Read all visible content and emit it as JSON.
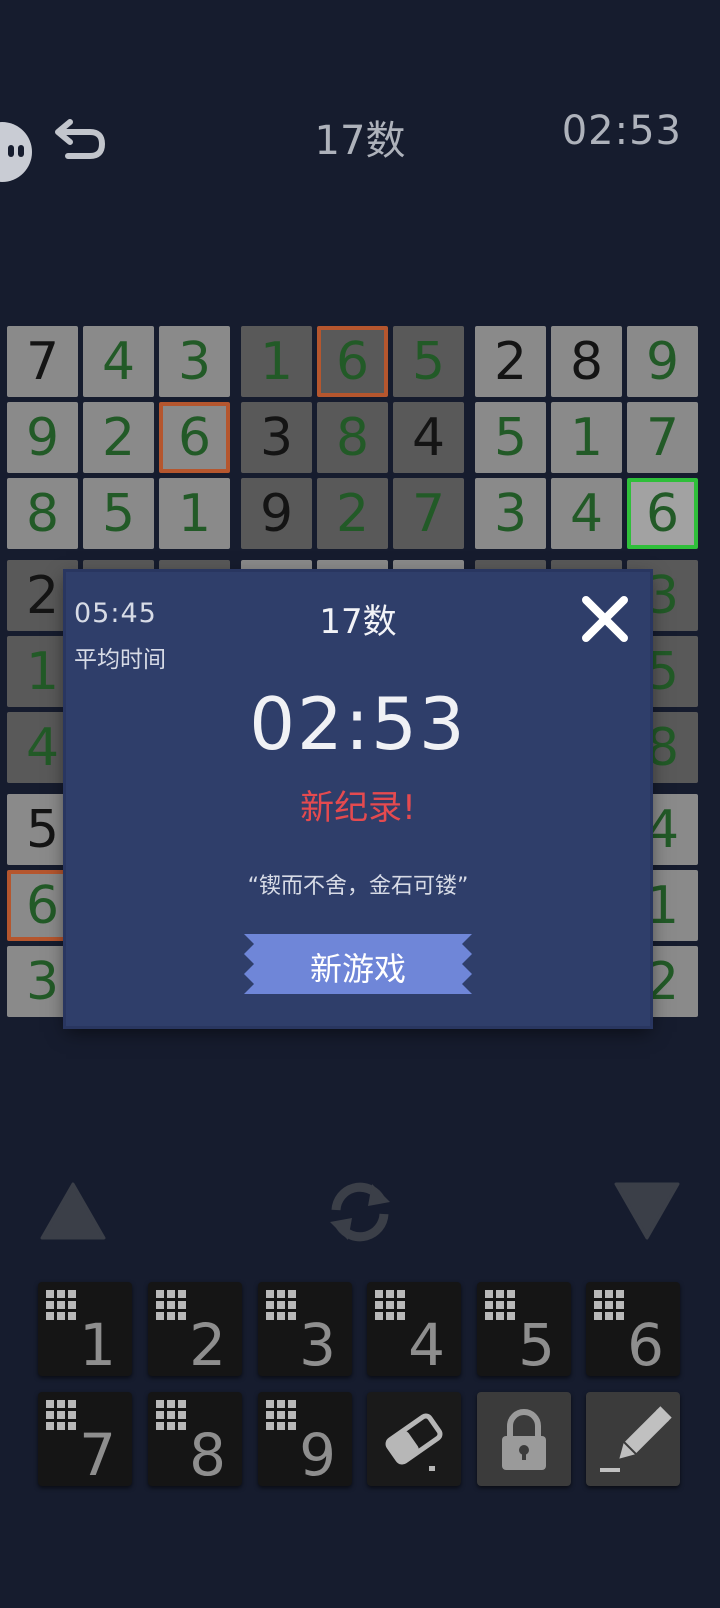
{
  "header": {
    "title": "17数",
    "timer": "02:53",
    "icons": [
      "avatar-icon",
      "undo-icon"
    ]
  },
  "board": [
    [
      7,
      4,
      3,
      1,
      6,
      5,
      2,
      8,
      9
    ],
    [
      9,
      2,
      6,
      3,
      8,
      4,
      5,
      1,
      7
    ],
    [
      8,
      5,
      1,
      9,
      2,
      7,
      3,
      4,
      6
    ],
    [
      2,
      "",
      "",
      "",
      "",
      "",
      "",
      "",
      3
    ],
    [
      1,
      "",
      "",
      "",
      "",
      "",
      "",
      "",
      5
    ],
    [
      4,
      "",
      "",
      "",
      "",
      "",
      "",
      "",
      8
    ],
    [
      5,
      "",
      "",
      "",
      "",
      "",
      "",
      "",
      4
    ],
    [
      6,
      "",
      "",
      "",
      "",
      "",
      "",
      "",
      1
    ],
    [
      3,
      "",
      "",
      "",
      "",
      "",
      "",
      "",
      2
    ]
  ],
  "board_given": [
    [
      1,
      0,
      0,
      0,
      0,
      0,
      1,
      1,
      0
    ],
    [
      0,
      0,
      0,
      1,
      0,
      1,
      0,
      0,
      0
    ],
    [
      0,
      0,
      0,
      1,
      0,
      0,
      0,
      0,
      0
    ],
    [
      1,
      0,
      0,
      0,
      0,
      0,
      0,
      0,
      0
    ],
    [
      0,
      0,
      0,
      0,
      0,
      0,
      0,
      0,
      0
    ],
    [
      0,
      0,
      0,
      0,
      0,
      0,
      0,
      0,
      0
    ],
    [
      1,
      0,
      0,
      0,
      0,
      0,
      0,
      0,
      0
    ],
    [
      0,
      0,
      0,
      0,
      0,
      0,
      0,
      0,
      0
    ],
    [
      0,
      0,
      0,
      0,
      0,
      0,
      0,
      0,
      0
    ]
  ],
  "conflict_cells": [
    [
      0,
      4
    ],
    [
      1,
      2
    ],
    [
      7,
      0
    ]
  ],
  "selected_cell": [
    2,
    8
  ],
  "colors": {
    "background": "#161c2e",
    "dialog": "#2f3e6a",
    "record_red": "#e54a4f",
    "button_blue": "#6f86d8",
    "user_digit_green": "#225a27",
    "conflict_orange": "#b5562e",
    "selected_green": "#2fbf3a"
  },
  "dialog": {
    "avg_time": "05:45",
    "avg_label": "平均时间",
    "title": "17数",
    "time": "02:53",
    "record_text": "新纪录!",
    "quote": "“锲而不舍，金石可镂”",
    "button_label": "新游戏",
    "close_icon": "close-icon"
  },
  "controls": {
    "icons": [
      "triangle-up-icon",
      "refresh-icon",
      "triangle-down-icon"
    ],
    "number_keys": [
      "1",
      "2",
      "3",
      "4",
      "5",
      "6",
      "7",
      "8",
      "9"
    ],
    "tool_icons": [
      "eraser-icon",
      "lock-icon",
      "pencil-icon"
    ]
  }
}
